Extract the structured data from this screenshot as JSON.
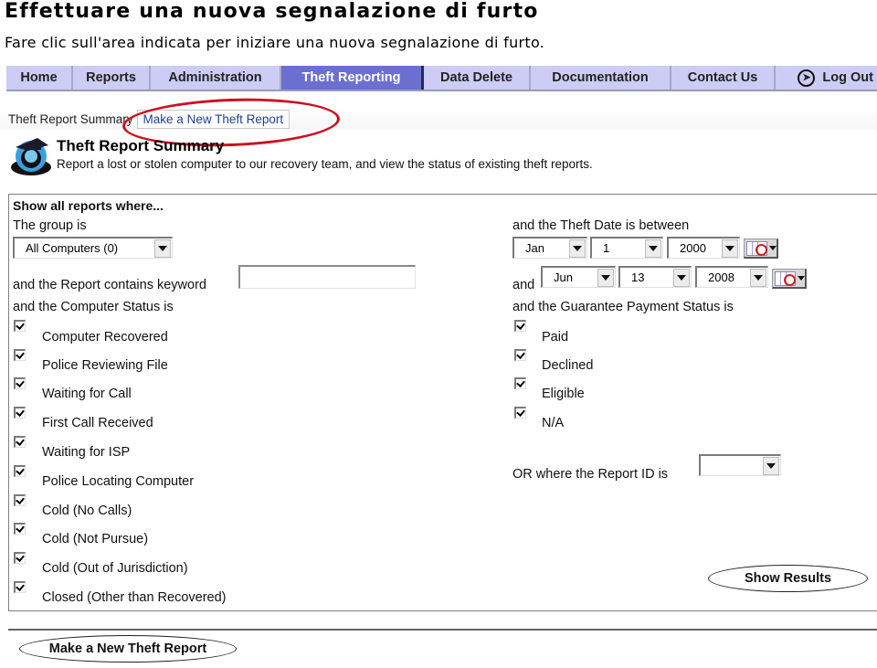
{
  "doc": {
    "title": "Effettuare una nuova segnalazione di furto",
    "subtitle": "Fare clic sull'area indicata per iniziare una nuova segnalazione di furto."
  },
  "nav": {
    "items": [
      {
        "label": "Home",
        "active": false
      },
      {
        "label": "Reports",
        "active": false
      },
      {
        "label": "Administration",
        "active": false
      },
      {
        "label": "Theft Reporting",
        "active": true
      },
      {
        "label": "Data Delete",
        "active": false
      },
      {
        "label": "Documentation",
        "active": false
      },
      {
        "label": "Contact Us",
        "active": false
      },
      {
        "label": "Log Out",
        "active": false,
        "icon": "logout-arrow-icon"
      }
    ]
  },
  "subtabs": {
    "current": "Theft Report Summary",
    "link": "Make a New Theft Report"
  },
  "header": {
    "title": "Theft Report Summary",
    "description": "Report a lost or stolen computer to our recovery team, and view the status of existing theft reports."
  },
  "filters": {
    "heading": "Show all reports where...",
    "group_label": "The group is",
    "group_value": "All Computers (0)",
    "keyword_label": "and the Report contains keyword",
    "keyword_value": "",
    "computer_status_label": "and the Computer Status is",
    "computer_statuses": [
      {
        "label": "Computer Recovered",
        "checked": true
      },
      {
        "label": "Police Reviewing File",
        "checked": true
      },
      {
        "label": "Waiting for Call",
        "checked": true
      },
      {
        "label": "First Call Received",
        "checked": true
      },
      {
        "label": "Waiting for ISP",
        "checked": true
      },
      {
        "label": "Police Locating Computer",
        "checked": true
      },
      {
        "label": "Cold (No Calls)",
        "checked": true
      },
      {
        "label": "Cold (Not Pursue)",
        "checked": true
      },
      {
        "label": "Cold (Out of Jurisdiction)",
        "checked": true
      },
      {
        "label": "Closed (Other than Recovered)",
        "checked": true
      }
    ],
    "theft_date_label": "and the Theft Date is between",
    "date_from": {
      "month": "Jan",
      "day": "1",
      "year": "2000"
    },
    "and_label": "and",
    "date_to": {
      "month": "Jun",
      "day": "13",
      "year": "2008"
    },
    "payment_status_label": "and the Guarantee Payment Status is",
    "payment_statuses": [
      {
        "label": "Paid",
        "checked": true
      },
      {
        "label": "Declined",
        "checked": true
      },
      {
        "label": "Eligible",
        "checked": true
      },
      {
        "label": "N/A",
        "checked": true
      }
    ],
    "report_id_label": "OR where the Report ID is",
    "report_id_value": "",
    "show_results_label": "Show Results"
  },
  "footer": {
    "new_report_label": "Make a New Theft Report"
  },
  "colors": {
    "nav_bg": "#ccccf5",
    "nav_active_bg": "#6b6fd0",
    "annotation_red": "#cc1122",
    "link_blue": "#1f3f8f"
  }
}
